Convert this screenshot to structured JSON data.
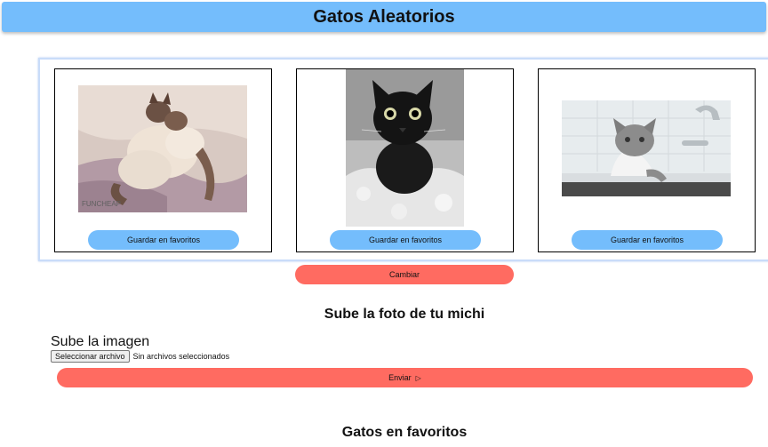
{
  "header": {
    "title": "Gatos Aleatorios"
  },
  "gallery": {
    "cards": [
      {
        "button_label": "Guardar en favoritos",
        "image_watermark": "FUNCHEAP"
      },
      {
        "button_label": "Guardar en favoritos"
      },
      {
        "button_label": "Guardar en favoritos"
      }
    ],
    "change_label": "Cambiar"
  },
  "upload": {
    "title": "Sube la foto de tu michi",
    "label": "Sube la imagen",
    "file_button": "Seleccionar archivo",
    "file_status": "Sin archivos seleccionados",
    "send_label": "Enviar",
    "send_icon": "send-icon"
  },
  "favorites": {
    "title": "Gatos en favoritos"
  },
  "colors": {
    "header_bg": "#74bdfc",
    "fav_button": "#74bdfc",
    "action_button": "#ff6b61"
  }
}
